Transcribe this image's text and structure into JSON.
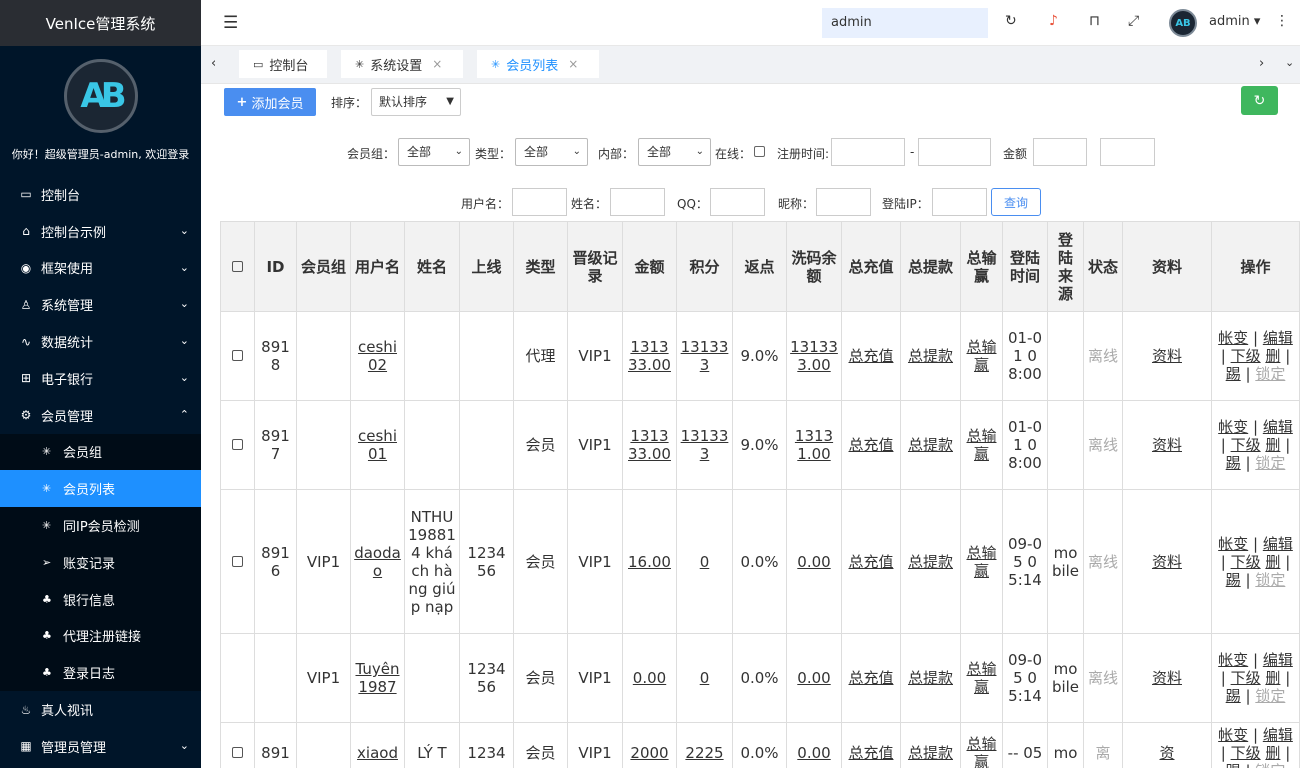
{
  "app": {
    "title": "VenIce管理系统"
  },
  "sidebar": {
    "avatar_text": "AB",
    "welcome": "你好！超级管理员-admin, 欢迎登录",
    "items": [
      {
        "label": "控制台",
        "icon": "monitor-icon"
      },
      {
        "label": "控制台示例",
        "icon": "home-icon"
      },
      {
        "label": "框架使用",
        "icon": "gear-circle-icon"
      },
      {
        "label": "系统管理",
        "icon": "user-icon"
      },
      {
        "label": "数据统计",
        "icon": "pulse-icon"
      },
      {
        "label": "电子银行",
        "icon": "bank-icon"
      },
      {
        "label": "会员管理",
        "icon": "gear-icon"
      }
    ],
    "subitems": [
      {
        "label": "会员组"
      },
      {
        "label": "会员列表"
      },
      {
        "label": "同IP会员检测"
      },
      {
        "label": "账变记录"
      },
      {
        "label": "银行信息"
      },
      {
        "label": "代理注册链接"
      },
      {
        "label": "登录日志"
      }
    ],
    "tail_items": [
      {
        "label": "真人视讯"
      },
      {
        "label": "管理员管理"
      }
    ]
  },
  "header": {
    "search_value": "admin",
    "user": "admin"
  },
  "tabs": [
    {
      "label": "控制台"
    },
    {
      "label": "系统设置"
    },
    {
      "label": "会员列表"
    }
  ],
  "toolbar": {
    "add_label": "添加会员",
    "sort_label": "排序：",
    "sort_value": "默认排序"
  },
  "filters": {
    "group_label": "会员组：",
    "group_value": "全部",
    "type_label": "类型：",
    "type_value": "全部",
    "internal_label": "内部：",
    "internal_value": "全部",
    "online_label": "在线：",
    "regtime_label": "注册时间:",
    "dash": "-",
    "amount_label": "金额",
    "username_label": "用户名：",
    "name_label": "姓名：",
    "qq_label": "QQ：",
    "nickname_label": "昵称：",
    "ip_label": "登陆IP：",
    "query_label": "查询"
  },
  "table": {
    "headers": [
      "ID",
      "会员组",
      "用户名",
      "姓名",
      "上线",
      "类型",
      "晋级记录",
      "金额",
      "积分",
      "返点",
      "洗码余额",
      "总充值",
      "总提款",
      "总输赢",
      "登陆时间",
      "登陆来源",
      "状态",
      "资料",
      "操作"
    ],
    "rows": [
      {
        "id": "8918",
        "group": "",
        "username": "ceshi02",
        "name": "",
        "parent": "",
        "type": "代理",
        "vip": "VIP1",
        "amount": "131333.00",
        "points": "131333",
        "rebate": "9.0%",
        "wash": "131333.00",
        "recharge": "总充值",
        "withdraw": "总提款",
        "winloss": "总输赢",
        "login_time": "01-01 08:00",
        "login_source": "",
        "status": "离线",
        "profile": "资料"
      },
      {
        "id": "8917",
        "group": "",
        "username": "ceshi01",
        "name": "",
        "parent": "",
        "type": "会员",
        "vip": "VIP1",
        "amount": "131333.00",
        "points": "131333",
        "rebate": "9.0%",
        "wash": "13131.00",
        "recharge": "总充值",
        "withdraw": "总提款",
        "winloss": "总输赢",
        "login_time": "01-01 08:00",
        "login_source": "",
        "status": "离线",
        "profile": "资料"
      },
      {
        "id": "8916",
        "group": "VIP1",
        "username": "daodao",
        "name": "NTHU198814 khách hàng giúp nạp",
        "parent": "123456",
        "type": "会员",
        "vip": "VIP1",
        "amount": "16.00",
        "points": "0",
        "rebate": "0.0%",
        "wash": "0.00",
        "recharge": "总充值",
        "withdraw": "总提款",
        "winloss": "总输赢",
        "login_time": "09-05 05:14",
        "login_source": "mobile",
        "status": "离线",
        "profile": "资料"
      },
      {
        "id": "",
        "group": "VIP1",
        "username": "Tuyên 1987",
        "name": "",
        "parent": "123456",
        "type": "会员",
        "vip": "VIP1",
        "amount": "0.00",
        "points": "0",
        "rebate": "0.0%",
        "wash": "0.00",
        "recharge": "总充值",
        "withdraw": "总提款",
        "winloss": "总输赢",
        "login_time": "09-05 05:14",
        "login_source": "mobile",
        "status": "离线",
        "profile": "资料"
      },
      {
        "id": "891",
        "group": "",
        "username": "xiaod",
        "name": "LÝ T",
        "parent": "1234",
        "type": "会员",
        "vip": "VIP1",
        "amount": "2000",
        "points": "2225",
        "rebate": "0.0%",
        "wash": "0.00",
        "recharge": "总充值",
        "withdraw": "总提款",
        "winloss": "总输赢",
        "login_time": "-- 05",
        "login_source": "mo",
        "status": "离",
        "profile": "资"
      }
    ],
    "ops": {
      "change": "帐变",
      "edit": "编辑",
      "sub": "下级",
      "del": "删",
      "kick": "踢",
      "lock": "锁定",
      "sep": "|"
    }
  }
}
